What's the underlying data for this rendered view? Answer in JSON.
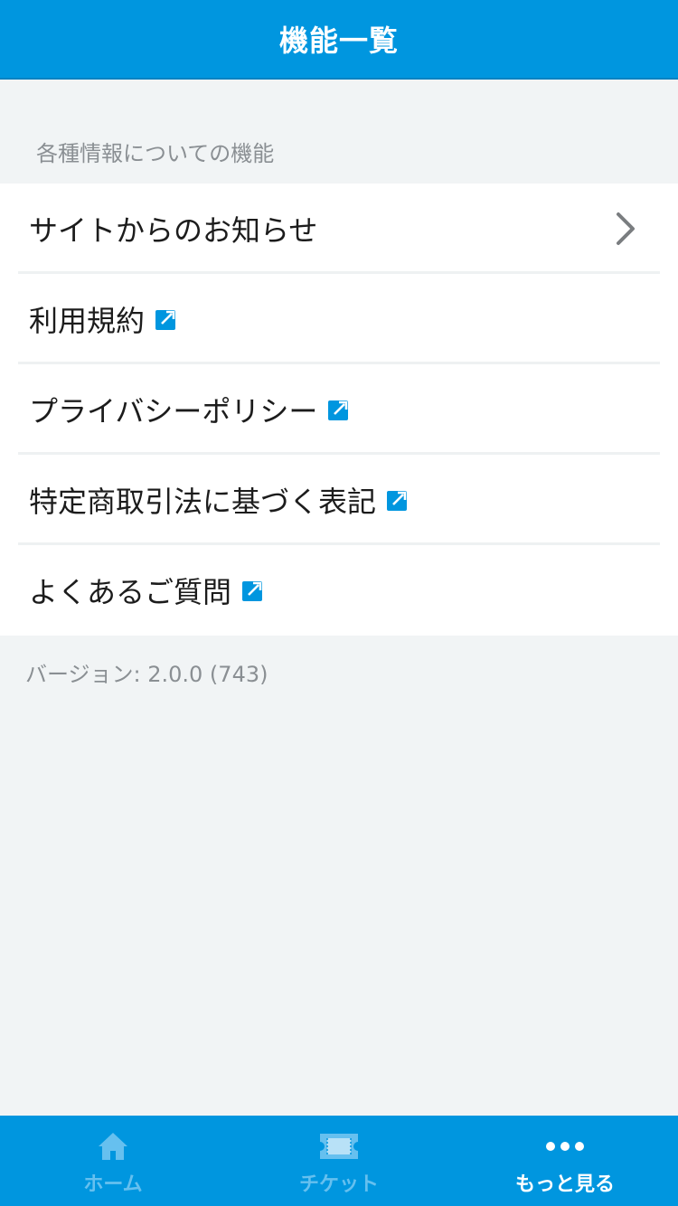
{
  "header": {
    "title": "機能一覧"
  },
  "section": {
    "label": "各種情報についての機能"
  },
  "items": [
    {
      "label": "サイトからのお知らせ",
      "type": "chevron"
    },
    {
      "label": "利用規約",
      "type": "external"
    },
    {
      "label": "プライバシーポリシー",
      "type": "external"
    },
    {
      "label": "特定商取引法に基づく表記",
      "type": "external"
    },
    {
      "label": "よくあるご質問",
      "type": "external"
    }
  ],
  "version": {
    "text": "バージョン: 2.0.0 (743)"
  },
  "tabs": [
    {
      "label": "ホーム",
      "icon": "home-icon",
      "active": false
    },
    {
      "label": "チケット",
      "icon": "ticket-icon",
      "active": false
    },
    {
      "label": "もっと見る",
      "icon": "more-icon",
      "active": true
    }
  ],
  "colors": {
    "accent": "#0096df",
    "background": "#f1f4f5",
    "inactive_tab": "#66c0ef",
    "external_icon": "#0096df"
  }
}
